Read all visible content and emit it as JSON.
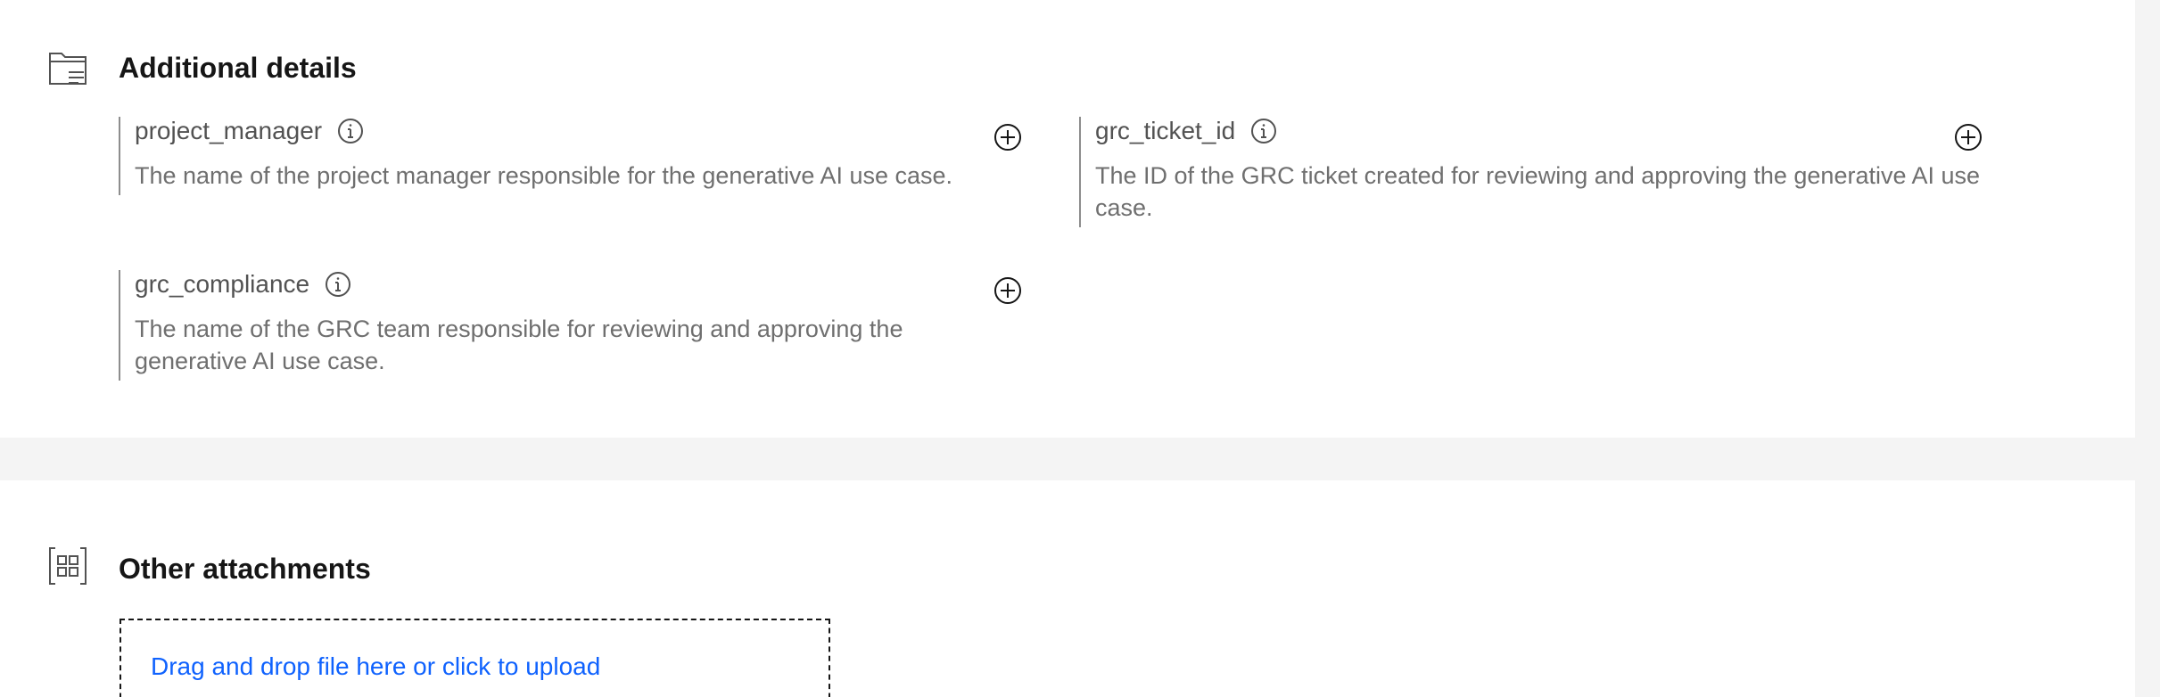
{
  "additional_details": {
    "title": "Additional details",
    "icon": "folder-details-icon",
    "fields": [
      {
        "label": "project_manager",
        "description": "The name of the project manager responsible for the generative AI use case."
      },
      {
        "label": "grc_ticket_id",
        "description": "The ID of the GRC ticket created for reviewing and approving the generative AI use case."
      },
      {
        "label": "grc_compliance",
        "description": "The name of the GRC team responsible for reviewing and approving the generative AI use case."
      }
    ]
  },
  "other_attachments": {
    "title": "Other attachments",
    "icon": "attachments-grid-icon",
    "dropzone_text": "Drag and drop file here or click to upload"
  },
  "colors": {
    "link": "#0f62fe",
    "label": "#525252",
    "description": "#6f6f6f",
    "background": "#f4f4f4",
    "panel": "#ffffff"
  }
}
